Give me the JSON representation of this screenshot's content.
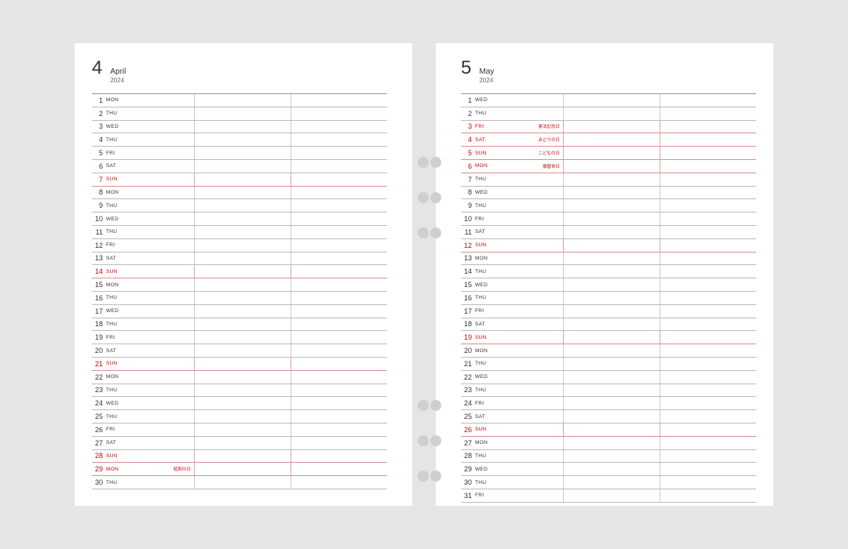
{
  "left": {
    "monthNum": "4",
    "monthName": "April",
    "year": "2024",
    "days": [
      {
        "n": "1",
        "a": "MON",
        "red": false,
        "h": ""
      },
      {
        "n": "2",
        "a": "THU",
        "red": false,
        "h": ""
      },
      {
        "n": "3",
        "a": "WED",
        "red": false,
        "h": ""
      },
      {
        "n": "4",
        "a": "THU",
        "red": false,
        "h": ""
      },
      {
        "n": "5",
        "a": "FRI",
        "red": false,
        "h": ""
      },
      {
        "n": "6",
        "a": "SAT",
        "red": false,
        "h": ""
      },
      {
        "n": "7",
        "a": "SUN",
        "red": true,
        "h": ""
      },
      {
        "n": "8",
        "a": "MON",
        "red": false,
        "h": ""
      },
      {
        "n": "9",
        "a": "THU",
        "red": false,
        "h": ""
      },
      {
        "n": "10",
        "a": "WED",
        "red": false,
        "h": ""
      },
      {
        "n": "11",
        "a": "THU",
        "red": false,
        "h": ""
      },
      {
        "n": "12",
        "a": "FRI",
        "red": false,
        "h": ""
      },
      {
        "n": "13",
        "a": "SAT",
        "red": false,
        "h": ""
      },
      {
        "n": "14",
        "a": "SUN",
        "red": true,
        "h": ""
      },
      {
        "n": "15",
        "a": "MON",
        "red": false,
        "h": ""
      },
      {
        "n": "16",
        "a": "THU",
        "red": false,
        "h": ""
      },
      {
        "n": "17",
        "a": "WED",
        "red": false,
        "h": ""
      },
      {
        "n": "18",
        "a": "THU",
        "red": false,
        "h": ""
      },
      {
        "n": "19",
        "a": "FRI",
        "red": false,
        "h": ""
      },
      {
        "n": "20",
        "a": "SAT",
        "red": false,
        "h": ""
      },
      {
        "n": "21",
        "a": "SUN",
        "red": true,
        "h": ""
      },
      {
        "n": "22",
        "a": "MON",
        "red": false,
        "h": ""
      },
      {
        "n": "23",
        "a": "THU",
        "red": false,
        "h": ""
      },
      {
        "n": "24",
        "a": "WED",
        "red": false,
        "h": ""
      },
      {
        "n": "25",
        "a": "THU",
        "red": false,
        "h": ""
      },
      {
        "n": "26",
        "a": "FRI",
        "red": false,
        "h": ""
      },
      {
        "n": "27",
        "a": "SAT",
        "red": false,
        "h": ""
      },
      {
        "n": "28",
        "a": "SUN",
        "red": true,
        "h": ""
      },
      {
        "n": "29",
        "a": "MON",
        "red": true,
        "h": "昭和の日"
      },
      {
        "n": "30",
        "a": "THU",
        "red": false,
        "h": ""
      }
    ]
  },
  "right": {
    "monthNum": "5",
    "monthName": "May",
    "year": "2024",
    "days": [
      {
        "n": "1",
        "a": "WED",
        "red": false,
        "h": ""
      },
      {
        "n": "2",
        "a": "THU",
        "red": false,
        "h": ""
      },
      {
        "n": "3",
        "a": "FRI",
        "red": true,
        "h": "憲法記念日"
      },
      {
        "n": "4",
        "a": "SAT",
        "red": true,
        "h": "みどりの日"
      },
      {
        "n": "5",
        "a": "SUN",
        "red": true,
        "h": "こどもの日"
      },
      {
        "n": "6",
        "a": "MON",
        "red": true,
        "h": "振替休日"
      },
      {
        "n": "7",
        "a": "THU",
        "red": false,
        "h": ""
      },
      {
        "n": "8",
        "a": "WED",
        "red": false,
        "h": ""
      },
      {
        "n": "9",
        "a": "THU",
        "red": false,
        "h": ""
      },
      {
        "n": "10",
        "a": "FRI",
        "red": false,
        "h": ""
      },
      {
        "n": "11",
        "a": "SAT",
        "red": false,
        "h": ""
      },
      {
        "n": "12",
        "a": "SUN",
        "red": true,
        "h": ""
      },
      {
        "n": "13",
        "a": "MON",
        "red": false,
        "h": ""
      },
      {
        "n": "14",
        "a": "THU",
        "red": false,
        "h": ""
      },
      {
        "n": "15",
        "a": "WED",
        "red": false,
        "h": ""
      },
      {
        "n": "16",
        "a": "THU",
        "red": false,
        "h": ""
      },
      {
        "n": "17",
        "a": "FRI",
        "red": false,
        "h": ""
      },
      {
        "n": "18",
        "a": "SAT",
        "red": false,
        "h": ""
      },
      {
        "n": "19",
        "a": "SUN",
        "red": true,
        "h": ""
      },
      {
        "n": "20",
        "a": "MON",
        "red": false,
        "h": ""
      },
      {
        "n": "21",
        "a": "THU",
        "red": false,
        "h": ""
      },
      {
        "n": "22",
        "a": "WED",
        "red": false,
        "h": ""
      },
      {
        "n": "23",
        "a": "THU",
        "red": false,
        "h": ""
      },
      {
        "n": "24",
        "a": "FRI",
        "red": false,
        "h": ""
      },
      {
        "n": "25",
        "a": "SAT",
        "red": false,
        "h": ""
      },
      {
        "n": "26",
        "a": "SUN",
        "red": true,
        "h": ""
      },
      {
        "n": "27",
        "a": "MON",
        "red": false,
        "h": ""
      },
      {
        "n": "28",
        "a": "THU",
        "red": false,
        "h": ""
      },
      {
        "n": "29",
        "a": "WED",
        "red": false,
        "h": ""
      },
      {
        "n": "30",
        "a": "THU",
        "red": false,
        "h": ""
      },
      {
        "n": "31",
        "a": "FRI",
        "red": false,
        "h": ""
      }
    ]
  }
}
